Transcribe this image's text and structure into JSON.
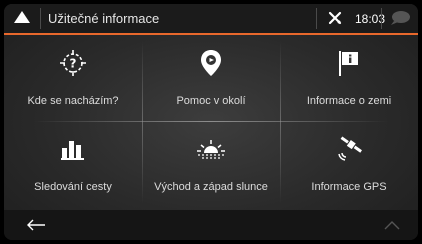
{
  "header": {
    "title": "Užitečné informace",
    "time": "18:03"
  },
  "menu": {
    "items": [
      {
        "label": "Kde se nacházím?",
        "icon": "location-question-icon"
      },
      {
        "label": "Pomoc v okolí",
        "icon": "help-pin-icon"
      },
      {
        "label": "Informace o zemi",
        "icon": "country-flag-info-icon"
      },
      {
        "label": "Sledování cesty",
        "icon": "bar-chart-icon"
      },
      {
        "label": "Východ a západ slunce",
        "icon": "sunrise-icon"
      },
      {
        "label": "Informace GPS",
        "icon": "satellite-icon"
      }
    ]
  },
  "colors": {
    "accent": "#e8682c",
    "header_bg": "#1b1b1b",
    "text": "#dcdcdc"
  }
}
